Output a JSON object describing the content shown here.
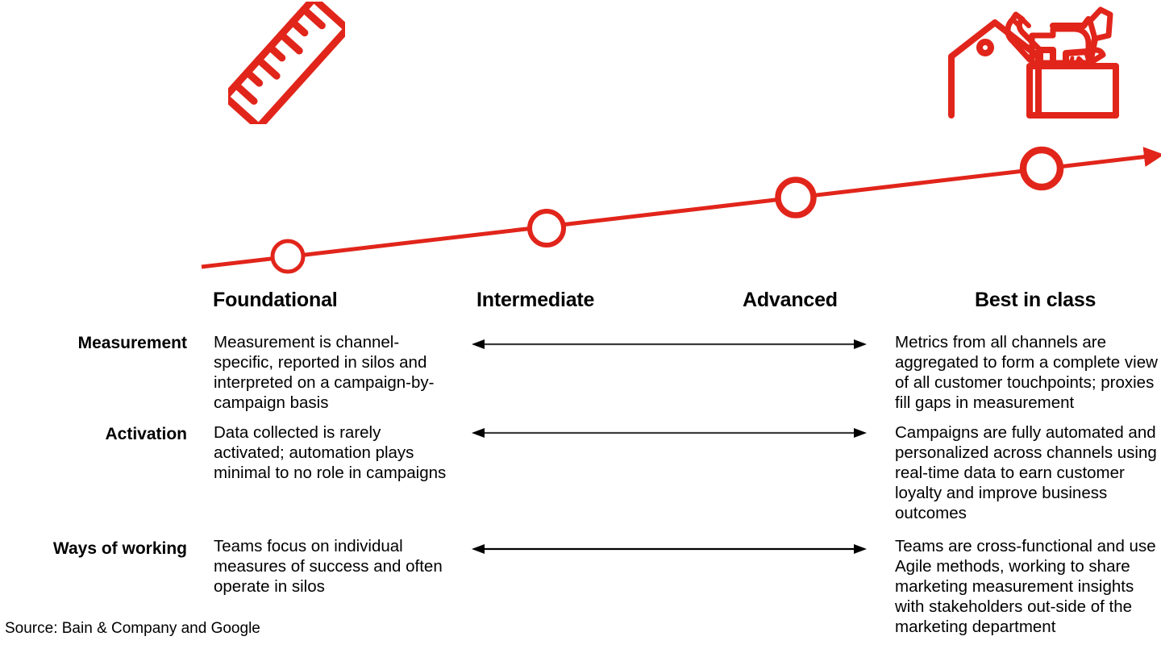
{
  "colors": {
    "accent_red": "#E1251B",
    "text_black": "#000000",
    "arrow_gray": "#3A3A3A"
  },
  "icons": {
    "ruler": "ruler-icon",
    "toolbox": "toolbox-icon",
    "progression_arrow": "red-progression-arrow"
  },
  "stages": [
    {
      "key": "foundational",
      "label": "Foundational"
    },
    {
      "key": "intermediate",
      "label": "Intermediate"
    },
    {
      "key": "advanced",
      "label": "Advanced"
    },
    {
      "key": "best_in_class",
      "label": "Best in class"
    }
  ],
  "rows": [
    {
      "label": "Measurement",
      "foundational": "Measurement is channel-specific, reported in silos and interpreted on a campaign-by-campaign basis",
      "best_in_class": "Metrics from all channels are aggregated to form a complete view of all customer touchpoints; proxies fill gaps in measurement"
    },
    {
      "label": "Activation",
      "foundational": "Data collected is rarely activated; automation plays minimal to no role in campaigns",
      "best_in_class": "Campaigns are fully automated and personalized across channels using real-time data to earn customer loyalty and improve business outcomes"
    },
    {
      "label": "Ways of working",
      "foundational": "Teams focus on individual measures of success and often operate in silos",
      "best_in_class": "Teams are cross-functional and use Agile methods, working to share marketing measurement insights with stakeholders out-side of the marketing department"
    }
  ],
  "source": "Source: Bain & Company and Google"
}
